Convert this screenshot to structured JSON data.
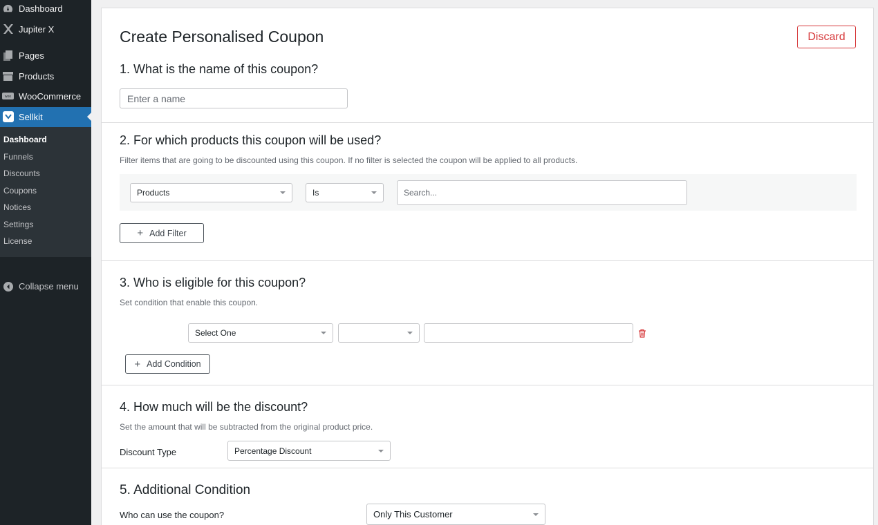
{
  "sidebar": {
    "items": [
      {
        "label": "Dashboard",
        "icon": "dashboard-icon"
      },
      {
        "label": "Jupiter X",
        "icon": "jupiter-x-icon"
      },
      {
        "label": "Pages",
        "icon": "pages-icon"
      },
      {
        "label": "Products",
        "icon": "products-icon"
      },
      {
        "label": "WooCommerce",
        "icon": "woocommerce-icon"
      },
      {
        "label": "Sellkit",
        "icon": "sellkit-icon"
      }
    ],
    "submenu": [
      "Dashboard",
      "Funnels",
      "Discounts",
      "Coupons",
      "Notices",
      "Settings",
      "License"
    ],
    "collapse_label": "Collapse menu"
  },
  "page": {
    "title": "Create Personalised Coupon",
    "discard_label": "Discard"
  },
  "s1": {
    "question": "1. What is the name of this coupon?",
    "name_placeholder": "Enter a name"
  },
  "s2": {
    "question": "2. For which products this coupon will be used?",
    "help": "Filter items that are going to be discounted using this coupon. If no filter is selected the coupon will be applied to all products.",
    "filter_type": "Products",
    "filter_operator": "Is",
    "search_placeholder": "Search...",
    "add_filter_label": "Add Filter"
  },
  "s3": {
    "question": "3. Who is eligible for this coupon?",
    "help": "Set condition that enable this coupon.",
    "condition_select": "Select One",
    "condition_operator": "",
    "condition_value": "",
    "add_condition_label": "Add Condition"
  },
  "s4": {
    "question": "4. How much will be the discount?",
    "help": "Set the amount that will be subtracted from the original product price.",
    "discount_type_label": "Discount Type",
    "discount_type_value": "Percentage Discount"
  },
  "s5": {
    "question": "5. Additional Condition",
    "who_label": "Who can use the coupon?",
    "who_value": "Only This Customer"
  },
  "colors": {
    "sidebar_bg": "#1d2327",
    "active_menu": "#2271b1",
    "discard": "#d63638"
  }
}
